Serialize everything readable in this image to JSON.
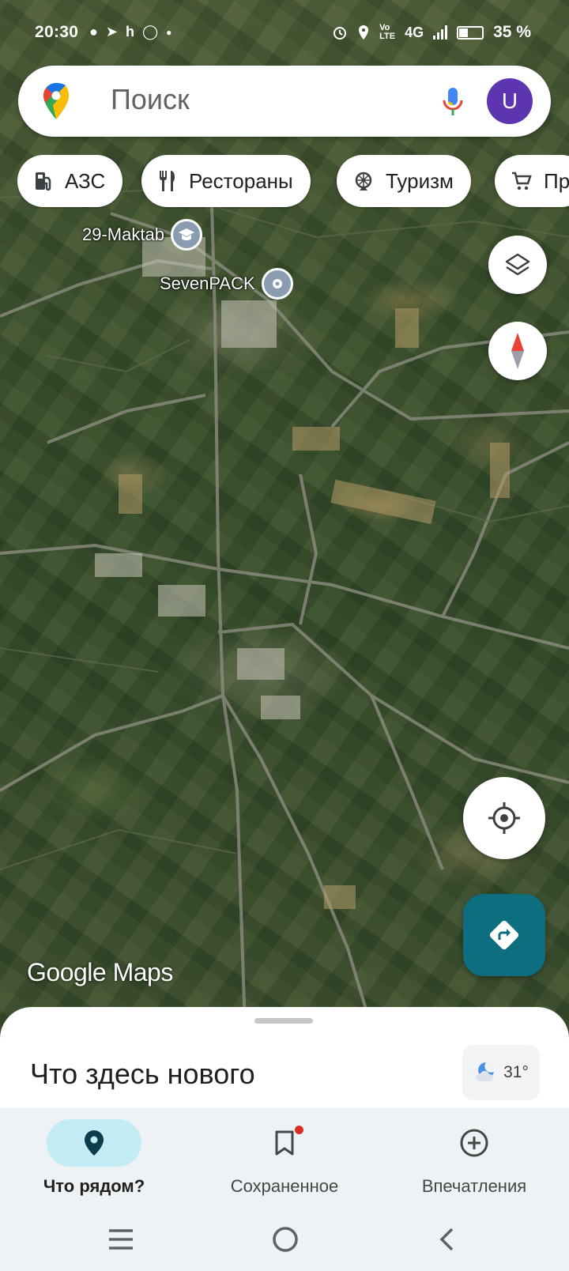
{
  "status_bar": {
    "time": "20:30",
    "notif_icons": [
      "chat-icon",
      "send-icon",
      "h-icon",
      "instagram-icon",
      "dot"
    ],
    "right_icons": [
      "alarm-icon",
      "location-icon",
      "volte-icon",
      "4g-icon",
      "signal-icon",
      "battery-icon"
    ],
    "network": "4G",
    "battery": "35 %"
  },
  "search": {
    "placeholder": "Поиск",
    "avatar_letter": "U",
    "avatar_color": "#5e35b1"
  },
  "chips": [
    {
      "label": "АЗС",
      "icon": "gas-station-icon"
    },
    {
      "label": "Рестораны",
      "icon": "restaurant-icon"
    },
    {
      "label": "Туризм",
      "icon": "tourism-icon"
    },
    {
      "label": "Пр",
      "icon": "cart-icon"
    }
  ],
  "map": {
    "places": [
      {
        "label": "29-Maktab",
        "icon": "school-icon"
      },
      {
        "label": "SevenPACK",
        "icon": "place-pin-icon"
      }
    ],
    "watermark_google": "Google",
    "watermark_maps": "Maps"
  },
  "sheet": {
    "title": "Что здесь нового",
    "temperature": "31°",
    "weather_icon": "partly-cloudy-night-icon"
  },
  "bottom_nav": [
    {
      "label": "Что рядом?",
      "icon": "explore-pin-icon",
      "active": true
    },
    {
      "label": "Сохраненное",
      "icon": "bookmark-icon",
      "active": false,
      "badge": true
    },
    {
      "label": "Впечатления",
      "icon": "add-circle-icon",
      "active": false
    }
  ],
  "colors": {
    "accent": "#0d6e80",
    "active_tab_bg": "#c3ecf5",
    "badge": "#d93025"
  }
}
